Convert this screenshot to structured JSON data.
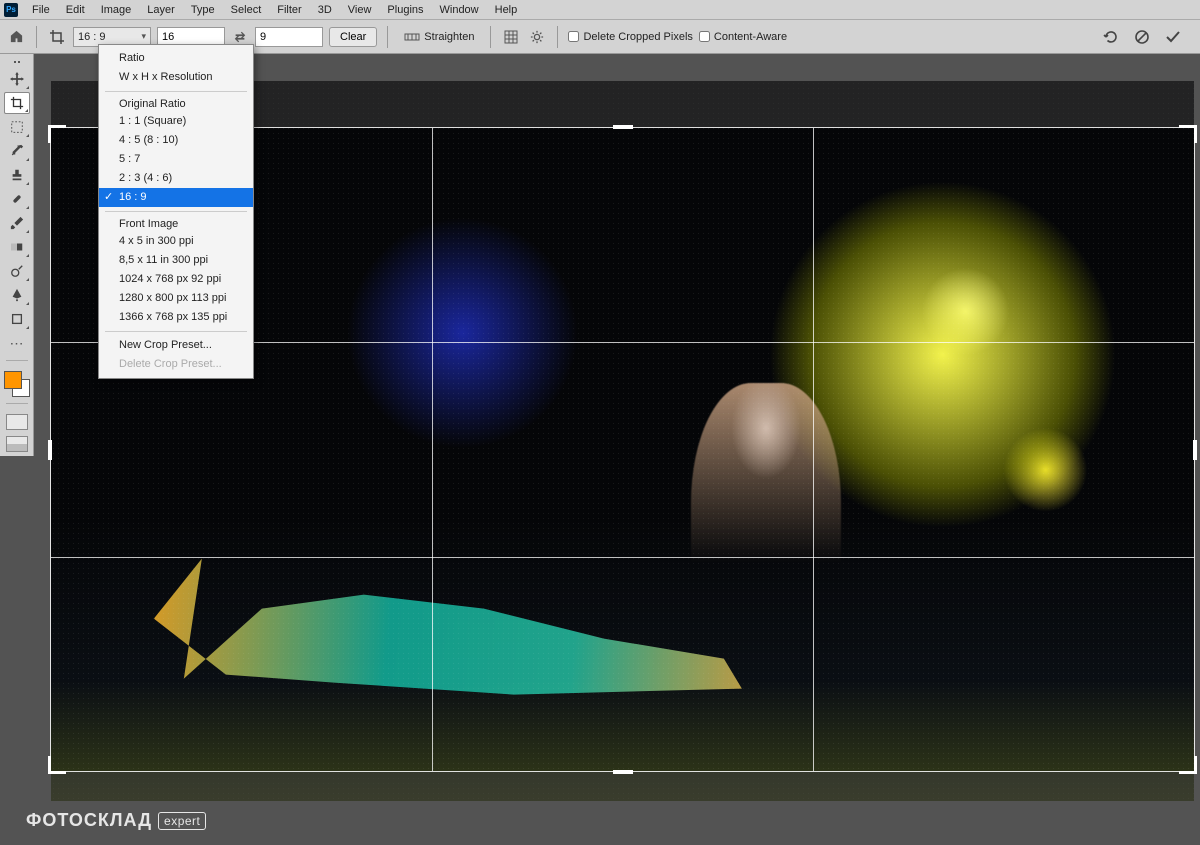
{
  "menu": [
    "File",
    "Edit",
    "Image",
    "Layer",
    "Type",
    "Select",
    "Filter",
    "3D",
    "View",
    "Plugins",
    "Window",
    "Help"
  ],
  "options": {
    "ratio_selected": "16 : 9",
    "width_value": "16",
    "height_value": "9",
    "clear": "Clear",
    "straighten": "Straighten",
    "delete_cropped": "Delete Cropped Pixels",
    "content_aware": "Content-Aware"
  },
  "dropdown": {
    "group1": [
      "Ratio",
      "W x H x Resolution"
    ],
    "group2_header": "Original Ratio",
    "group2": [
      "1 : 1 (Square)",
      "4 : 5 (8 : 10)",
      "5 : 7",
      "2 : 3 (4 : 6)",
      "16 : 9"
    ],
    "group3_header": "Front Image",
    "group3": [
      "4 x 5 in 300 ppi",
      "8,5 x 11 in 300 ppi",
      "1024 x 768 px 92 ppi",
      "1280 x 800 px 113 ppi",
      "1366 x 768 px 135 ppi"
    ],
    "group4": [
      "New Crop Preset..."
    ],
    "group4_disabled": "Delete Crop Preset..."
  },
  "watermark": {
    "brand": "ФОТОСКЛАД",
    "tag": "expert"
  }
}
